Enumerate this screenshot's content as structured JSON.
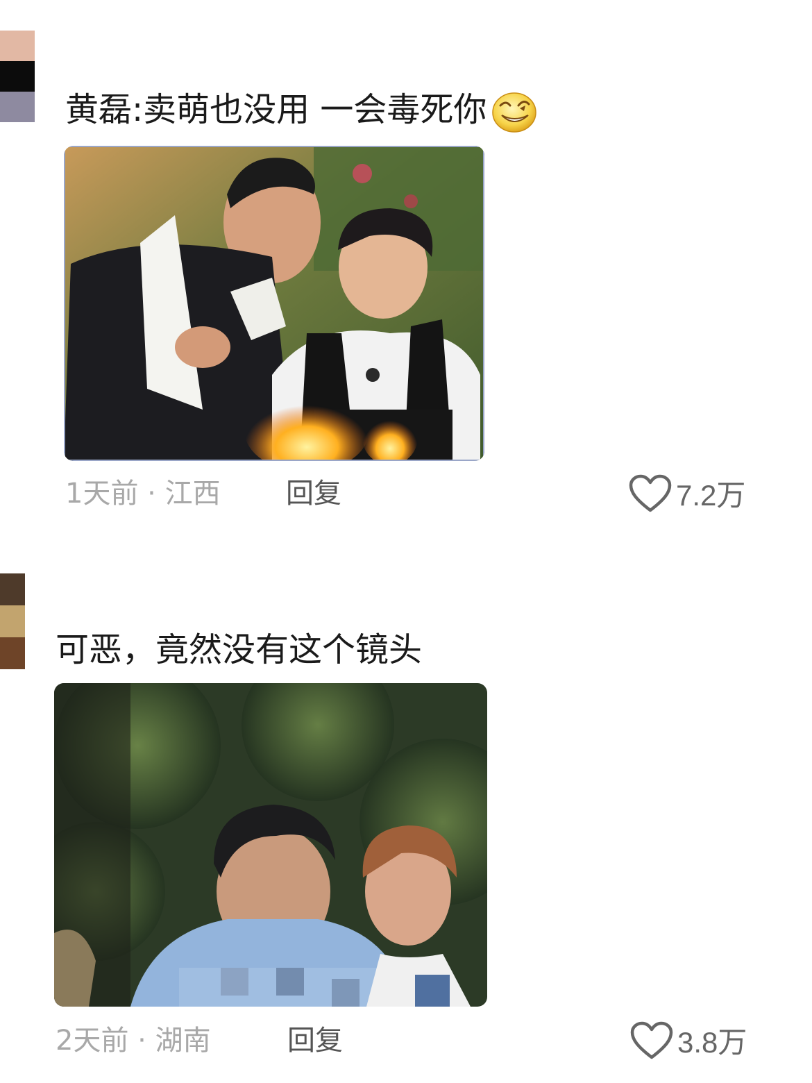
{
  "comments": [
    {
      "text": "黄磊:卖萌也没用 一会毒死你",
      "emoji_icon": "grinning-squint-emoji",
      "time": "1天前",
      "location": "江西",
      "separator": "·",
      "reply_label": "回复",
      "like_count": "7.2万",
      "image_alt": "two men by a campfire, one smiling up at the other"
    },
    {
      "text": "可恶，竟然没有这个镜头",
      "time": "2天前",
      "location": "湖南",
      "separator": "·",
      "reply_label": "回复",
      "like_count": "3.8万",
      "image_alt": "two men outdoors in front of dense foliage, one grimacing"
    }
  ],
  "colors": {
    "text": "#1a1a1a",
    "meta": "#a8a8a8",
    "reply": "#555555",
    "like_icon": "#666666"
  }
}
